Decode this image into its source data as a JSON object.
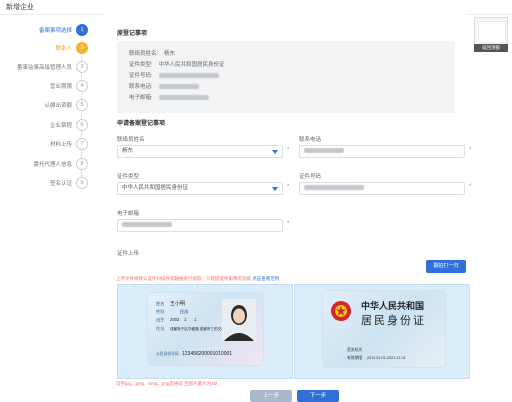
{
  "window": {
    "title": "新增企业"
  },
  "stepper": {
    "steps": [
      {
        "label": "备案事项选择",
        "number": "1",
        "state": "done"
      },
      {
        "label": "联系人",
        "number": "2",
        "state": "active"
      },
      {
        "label": "董事监事高级管理人员",
        "number": "3",
        "state": "todo"
      },
      {
        "label": "营业期限",
        "number": "4",
        "state": "todo"
      },
      {
        "label": "认缴出资额",
        "number": "5",
        "state": "todo"
      },
      {
        "label": "企业章程",
        "number": "6",
        "state": "todo"
      },
      {
        "label": "材料上传",
        "number": "7",
        "state": "todo"
      },
      {
        "label": "委托代理人信息",
        "number": "8",
        "state": "todo"
      },
      {
        "label": "签名认证",
        "number": "9",
        "state": "todo"
      }
    ]
  },
  "original": {
    "title": "原登记事项",
    "rows": [
      {
        "label": "联络员姓名:",
        "value": "杨东"
      },
      {
        "label": "证件类型:",
        "value": "中华人民共和国居民身份证"
      },
      {
        "label": "证件号码:",
        "value": ""
      },
      {
        "label": "联系电话:",
        "value": ""
      },
      {
        "label": "电子邮箱:",
        "value": ""
      }
    ]
  },
  "apply": {
    "title": "申请备案登记事项",
    "name_label": "联络员姓名",
    "name_value": "杨东",
    "phone_label": "联系电话",
    "id_type_label": "证件类型",
    "id_type_value": "中华人民共和国居民身份证",
    "id_no_label": "证件号码",
    "email_label": "电子邮箱",
    "upload_label": "证件上传",
    "upload_button": "翻拍打一归",
    "hint": "上传文件将默认证件扫描件或翻拍进行提取；只能提证件影像的功能",
    "hint_link": "点击查看范例"
  },
  "id_front": {
    "name_label": "姓名",
    "name_value": "王小明",
    "sex_label": "性别",
    "ethnic_label": "民族",
    "birth_label": "出生",
    "year": "2002",
    "month": "1",
    "day": "1",
    "address_label": "住址",
    "address_value": "成都新宁区华盛路 成都市三的交汇处的",
    "id_label": "公民身份号码",
    "id_value": "123456200001010001"
  },
  "id_back": {
    "country": "中华人民共和国",
    "title": "居民身份证",
    "authority_label": "签发机关",
    "validity_label": "有效期限",
    "validity_value": "2011.01.01-2021.11.01"
  },
  "footer": {
    "note": "可传jpg，jpeg，bmp，png等格式 且图片最大为1M",
    "prev": "上一步",
    "next": "下一步"
  },
  "sidebar_thumb": {
    "label": "返回顶部"
  }
}
